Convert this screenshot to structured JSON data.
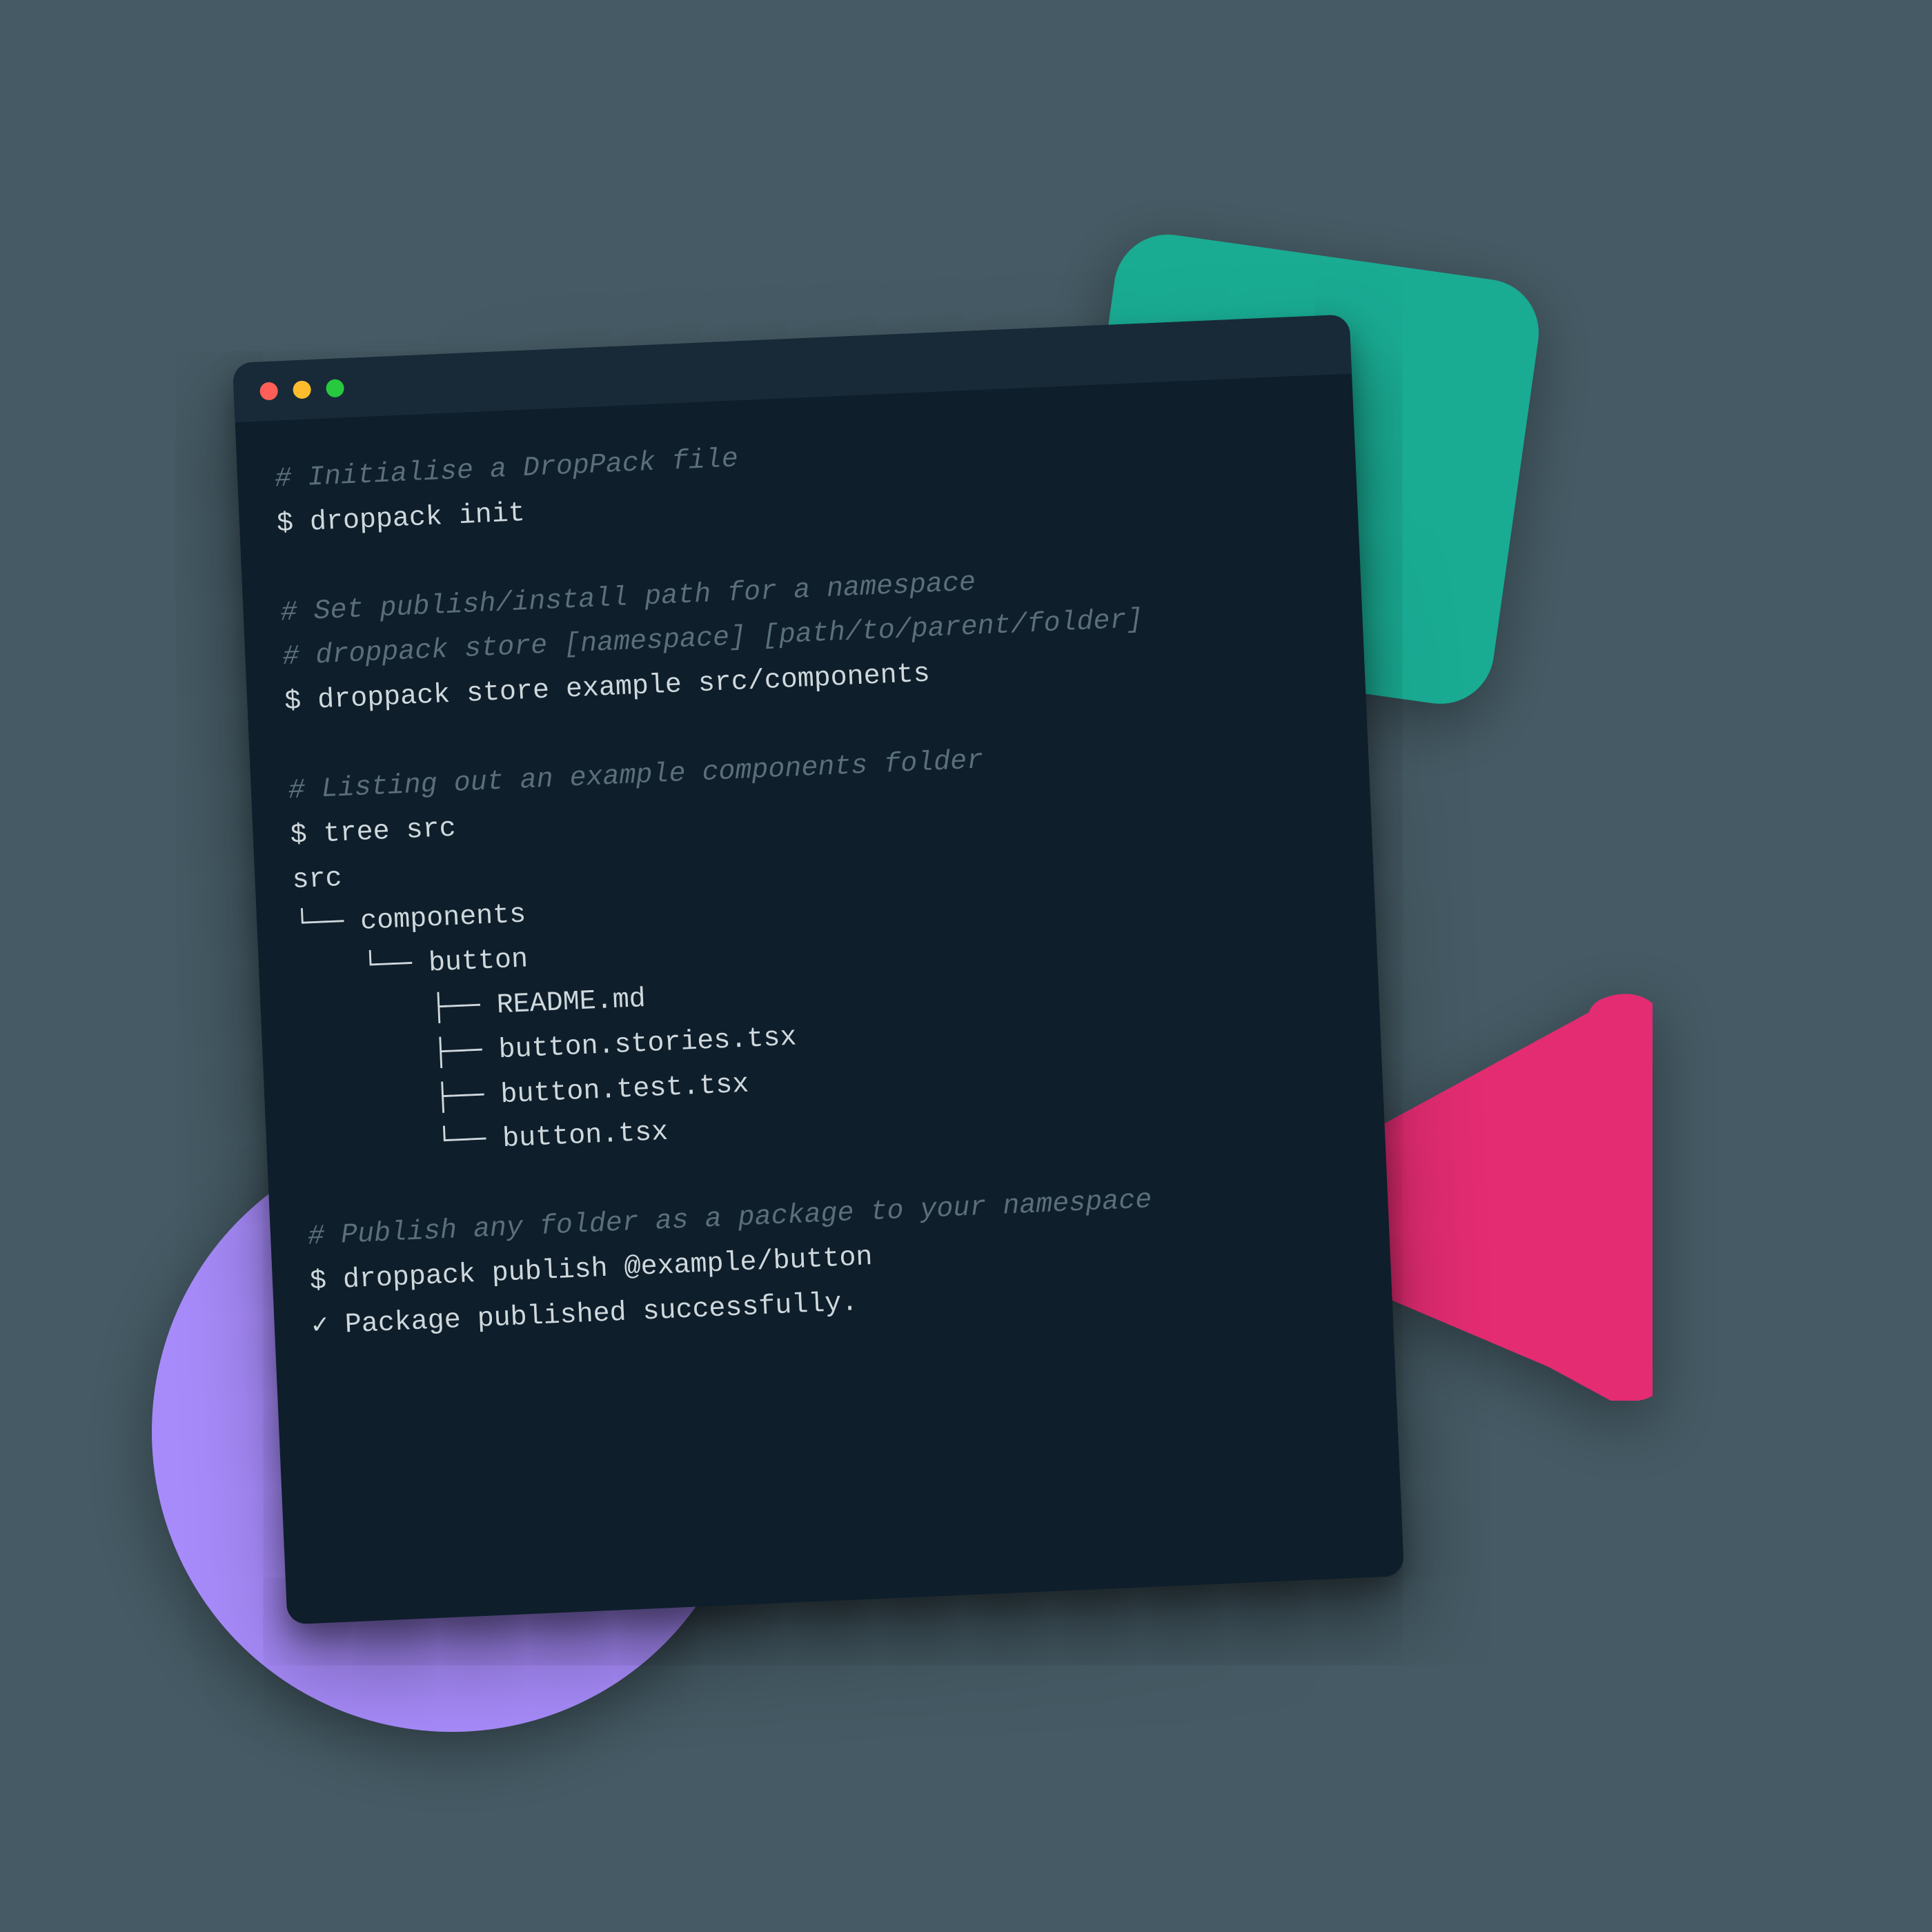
{
  "colors": {
    "bg": "#455a64",
    "term_bg": "#0e1e2b",
    "titlebar": "#182a38",
    "comment": "#5a6f7a",
    "text": "#cfd8dc",
    "teal": "#1aab93",
    "pink": "#e32c72",
    "purple": "#a78bfa"
  },
  "traffic_lights": [
    "#ff5f56",
    "#ffbd2e",
    "#27c93f"
  ],
  "terminal": {
    "prompt": "$",
    "lines": [
      {
        "kind": "comment",
        "text": "# Initialise a DropPack file"
      },
      {
        "kind": "cmd",
        "text": "$ droppack init"
      },
      {
        "kind": "spacer"
      },
      {
        "kind": "comment",
        "text": "# Set publish/install path for a namespace"
      },
      {
        "kind": "comment",
        "text": "# droppack store [namespace] [path/to/parent/folder]"
      },
      {
        "kind": "cmd",
        "text": "$ droppack store example src/components"
      },
      {
        "kind": "spacer"
      },
      {
        "kind": "comment",
        "text": "# Listing out an example components folder"
      },
      {
        "kind": "cmd",
        "text": "$ tree src"
      },
      {
        "kind": "out",
        "text": "src"
      },
      {
        "kind": "out",
        "text": "└── components"
      },
      {
        "kind": "out",
        "text": "    └── button"
      },
      {
        "kind": "out",
        "text": "        ├── README.md"
      },
      {
        "kind": "out",
        "text": "        ├── button.stories.tsx"
      },
      {
        "kind": "out",
        "text": "        ├── button.test.tsx"
      },
      {
        "kind": "out",
        "text": "        └── button.tsx"
      },
      {
        "kind": "spacer"
      },
      {
        "kind": "comment",
        "text": "# Publish any folder as a package to your namespace"
      },
      {
        "kind": "cmd",
        "text": "$ droppack publish @example/button"
      },
      {
        "kind": "out",
        "text": "✓ Package published successfully."
      }
    ]
  }
}
